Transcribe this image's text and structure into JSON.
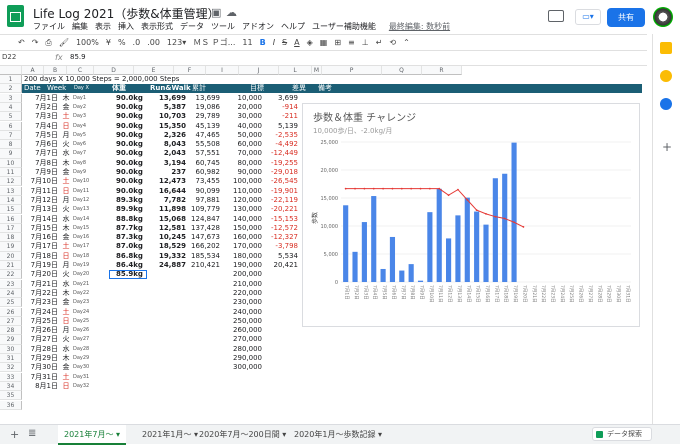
{
  "app": {
    "title": "Life Log 2021（歩数&体重管理）",
    "last_edit": "最終編集: 数秒前",
    "share": "共有"
  },
  "menu": [
    "ファイル",
    "編集",
    "表示",
    "挿入",
    "表示形式",
    "データ",
    "ツール",
    "アドオン",
    "ヘルプ",
    "ユーザー補助機能"
  ],
  "toolbar": {
    "zoom": "100%",
    "currency": "¥",
    "percent": "%",
    "dec0": ".0",
    "dec00": ".00",
    "numfmt": "123▾",
    "font": "ＭＳ Ｐゴ...",
    "size": "11",
    "bold": "B",
    "italic": "I",
    "strike": "S",
    "color": "A"
  },
  "formula": {
    "name": "D22",
    "value": "85.9"
  },
  "columns": [
    "A",
    "B",
    "C",
    "D",
    "E",
    "F",
    "",
    "I",
    "",
    "",
    "J",
    "",
    "L",
    "M",
    "",
    "",
    "P",
    "",
    "Q",
    "R"
  ],
  "header_row1": "200 days X 10,000 Steps = 2,000,000 Steps",
  "header_row2": {
    "date": "Date",
    "week": "Week",
    "dayx": "Day X",
    "weight": "体重",
    "run": "Run&Walk",
    "total": "累計",
    "goal": "目標",
    "diff": "差異",
    "note": "備考"
  },
  "rows": [
    [
      "7月1日",
      "木",
      "Day1",
      "90.0kg",
      "13,699",
      "13,699",
      "10,000",
      "3,699"
    ],
    [
      "7月2日",
      "金",
      "Day2",
      "90.0kg",
      "5,387",
      "19,086",
      "20,000",
      "-914"
    ],
    [
      "7月3日",
      "土",
      "Day3",
      "90.0kg",
      "10,703",
      "29,789",
      "30,000",
      "-211"
    ],
    [
      "7月4日",
      "日",
      "Day4",
      "90.0kg",
      "15,350",
      "45,139",
      "40,000",
      "5,139"
    ],
    [
      "7月5日",
      "月",
      "Day5",
      "90.0kg",
      "2,326",
      "47,465",
      "50,000",
      "-2,535"
    ],
    [
      "7月6日",
      "火",
      "Day6",
      "90.0kg",
      "8,043",
      "55,508",
      "60,000",
      "-4,492"
    ],
    [
      "7月7日",
      "水",
      "Day7",
      "90.0kg",
      "2,043",
      "57,551",
      "70,000",
      "-12,449"
    ],
    [
      "7月8日",
      "木",
      "Day8",
      "90.0kg",
      "3,194",
      "60,745",
      "80,000",
      "-19,255"
    ],
    [
      "7月9日",
      "金",
      "Day9",
      "90.0kg",
      "237",
      "60,982",
      "90,000",
      "-29,018"
    ],
    [
      "7月10日",
      "土",
      "Day10",
      "90.0kg",
      "12,473",
      "73,455",
      "100,000",
      "-26,545"
    ],
    [
      "7月11日",
      "日",
      "Day11",
      "90.0kg",
      "16,644",
      "90,099",
      "110,000",
      "-19,901"
    ],
    [
      "7月12日",
      "月",
      "Day12",
      "89.3kg",
      "7,782",
      "97,881",
      "120,000",
      "-22,119"
    ],
    [
      "7月13日",
      "火",
      "Day13",
      "89.9kg",
      "11,898",
      "109,779",
      "130,000",
      "-20,221"
    ],
    [
      "7月14日",
      "水",
      "Day14",
      "88.8kg",
      "15,068",
      "124,847",
      "140,000",
      "-15,153"
    ],
    [
      "7月15日",
      "木",
      "Day15",
      "87.7kg",
      "12,581",
      "137,428",
      "150,000",
      "-12,572"
    ],
    [
      "7月16日",
      "金",
      "Day16",
      "87.3kg",
      "10,245",
      "147,673",
      "160,000",
      "-12,327"
    ],
    [
      "7月17日",
      "土",
      "Day17",
      "87.0kg",
      "18,529",
      "166,202",
      "170,000",
      "-3,798"
    ],
    [
      "7月18日",
      "日",
      "Day18",
      "86.8kg",
      "19,332",
      "185,534",
      "180,000",
      "5,534"
    ],
    [
      "7月19日",
      "月",
      "Day19",
      "86.4kg",
      "24,887",
      "210,421",
      "190,000",
      "20,421"
    ],
    [
      "7月20日",
      "火",
      "Day20",
      "85.9kg",
      "",
      "",
      "200,000",
      ""
    ],
    [
      "7月21日",
      "水",
      "Day21",
      "",
      "",
      "",
      "210,000",
      ""
    ],
    [
      "7月22日",
      "木",
      "Day22",
      "",
      "",
      "",
      "220,000",
      ""
    ],
    [
      "7月23日",
      "金",
      "Day23",
      "",
      "",
      "",
      "230,000",
      ""
    ],
    [
      "7月24日",
      "土",
      "Day24",
      "",
      "",
      "",
      "240,000",
      ""
    ],
    [
      "7月25日",
      "日",
      "Day25",
      "",
      "",
      "",
      "250,000",
      ""
    ],
    [
      "7月26日",
      "月",
      "Day26",
      "",
      "",
      "",
      "260,000",
      ""
    ],
    [
      "7月27日",
      "火",
      "Day27",
      "",
      "",
      "",
      "270,000",
      ""
    ],
    [
      "7月28日",
      "水",
      "Day28",
      "",
      "",
      "",
      "280,000",
      ""
    ],
    [
      "7月29日",
      "木",
      "Day29",
      "",
      "",
      "",
      "290,000",
      ""
    ],
    [
      "7月30日",
      "金",
      "Day30",
      "",
      "",
      "",
      "300,000",
      ""
    ],
    [
      "7月31日",
      "土",
      "Day31",
      "",
      "",
      "",
      "",
      ""
    ],
    [
      "8月1日",
      "日",
      "Day32",
      "",
      "",
      "",
      "",
      ""
    ]
  ],
  "sheets": [
    "2021年7月〜",
    "2021年1月〜",
    "2020年7月〜200日間",
    "2020年1月〜歩数記録"
  ],
  "explore": "データ探索",
  "colors": {
    "green": "#188038",
    "header_bg": "#1b5e75",
    "red": "#d93025",
    "blue": "#1a73e8"
  },
  "chart_data": {
    "type": "bar",
    "title": "歩数＆体重 チャレンジ",
    "subtitle": "10,000歩/日、-2.0kg/月",
    "ylabel": "歩数",
    "ylim": [
      0,
      25000
    ],
    "yticks": [
      "25,000",
      "20,000",
      "15,000",
      "10,000",
      "5,000",
      "0"
    ],
    "categories": [
      "7月1日",
      "7月2日",
      "7月3日",
      "7月4日",
      "7月5日",
      "7月6日",
      "7月7日",
      "7月8日",
      "7月9日",
      "7月10日",
      "7月11日",
      "7月12日",
      "7月13日",
      "7月14日",
      "7月15日",
      "7月16日",
      "7月17日",
      "7月18日",
      "7月19日",
      "7月20日",
      "7月21日",
      "7月22日",
      "7月23日",
      "7月24日",
      "7月25日",
      "7月26日",
      "7月27日",
      "7月28日",
      "7月29日",
      "7月30日",
      "7月31日"
    ],
    "steps": [
      13699,
      5387,
      10703,
      15350,
      2326,
      8043,
      2043,
      3194,
      237,
      12473,
      16644,
      7782,
      11898,
      15068,
      12581,
      10245,
      18529,
      19332,
      24887
    ],
    "weight": [
      90.0,
      90.0,
      90.0,
      90.0,
      90.0,
      90.0,
      90.0,
      90.0,
      90.0,
      90.0,
      90.0,
      89.3,
      89.9,
      88.8,
      87.7,
      87.3,
      87.0,
      86.8,
      86.4,
      85.9
    ],
    "weight_range": [
      80,
      95
    ]
  }
}
